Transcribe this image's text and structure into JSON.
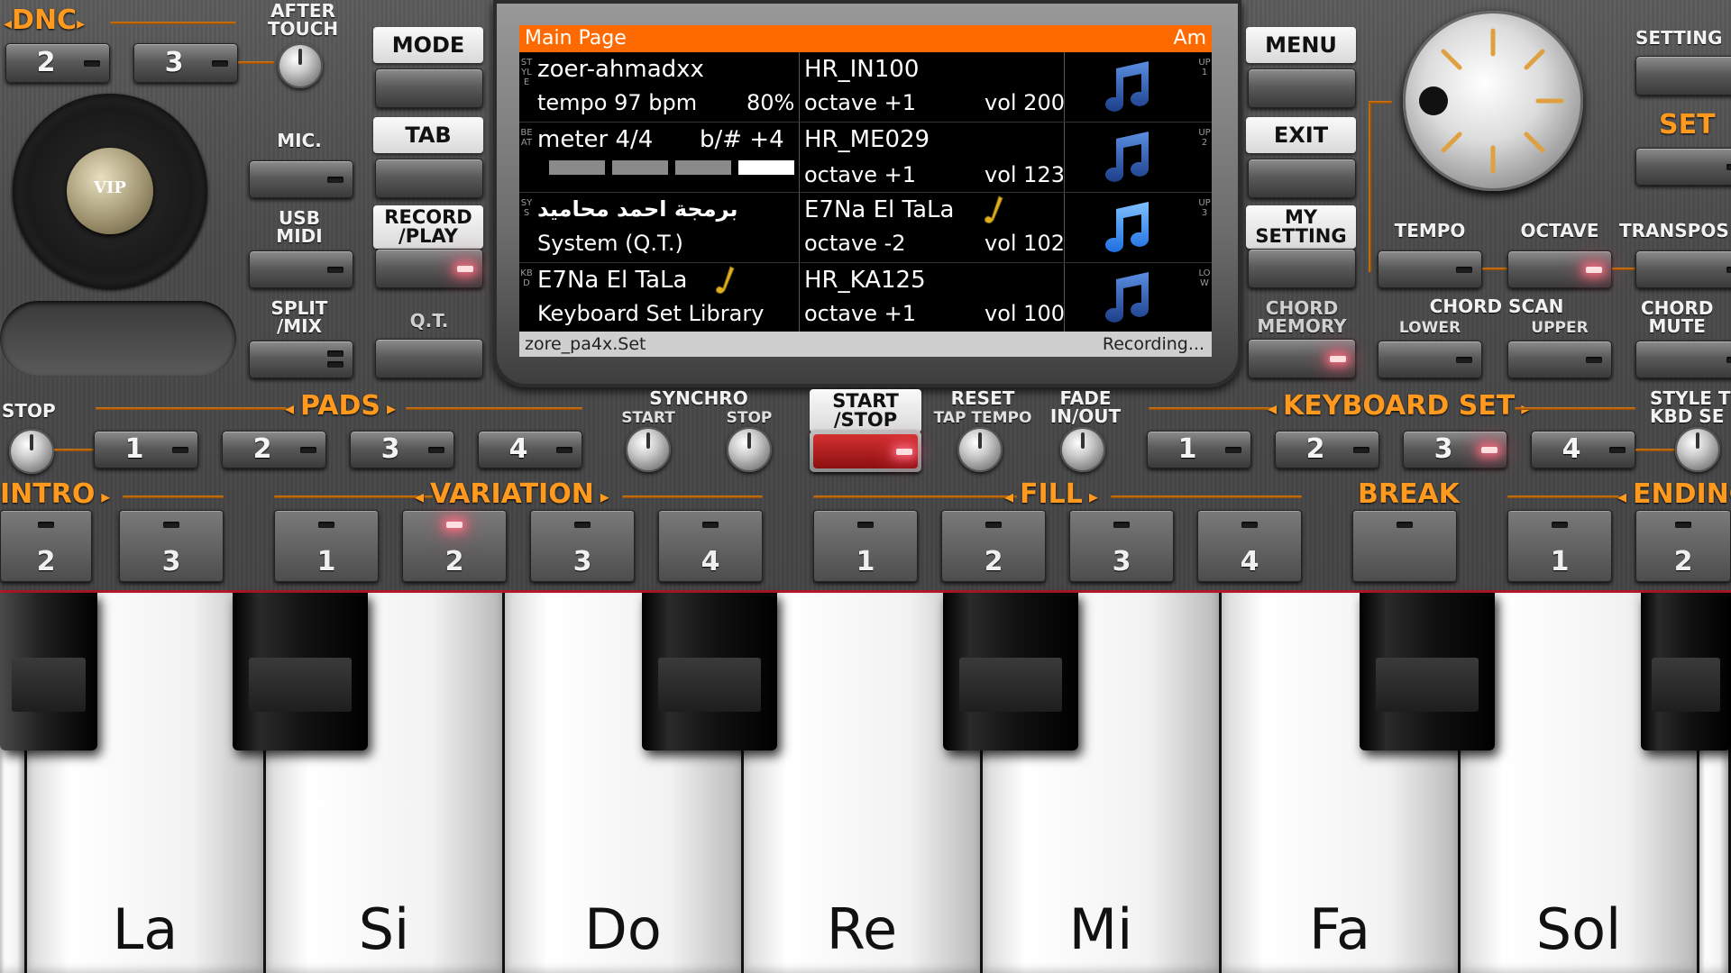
{
  "colors": {
    "accent": "#ff9a1f",
    "screen_header": "#ff6a00",
    "led_on": "#ff6e82",
    "record_button": "#b51d1d"
  },
  "top_left": {
    "dnc": "DNC",
    "dnc_buttons": [
      "2",
      "3"
    ],
    "after_touch": [
      "AFTER",
      "TOUCH"
    ],
    "mic": "MIC.",
    "usb_midi": [
      "USB",
      "MIDI"
    ],
    "split_mix": [
      "SPLIT",
      "/MIX"
    ],
    "logo_text": "VIP"
  },
  "mode_buttons": {
    "mode": "MODE",
    "tab": "TAB",
    "record_play": [
      "RECORD",
      "/PLAY"
    ],
    "qt": "Q.T."
  },
  "screen": {
    "title": "Main Page",
    "key": "Am",
    "rows": [
      {
        "side": "STYLE",
        "left_top": "zoer-ahmadxx",
        "left_bottom": "tempo 97 bpm",
        "left_extra": "80%",
        "right_top": "HR_IN100",
        "right_bottom": "octave +1",
        "volume": "vol 200",
        "tag": "UP1",
        "note_icon": "music-note-dark"
      },
      {
        "side": "BEAT",
        "left_top": "meter 4/4",
        "left_extra": "b/# +4",
        "right_top": "HR_ME029",
        "right_bottom": "octave +1",
        "volume": "vol 123",
        "tag": "UP2",
        "note_icon": "music-note-dark",
        "beat_bars": [
          false,
          false,
          false,
          true
        ]
      },
      {
        "side": "SYS",
        "left_top": "برمجة احمد محاميد",
        "left_bottom": "System (Q.T.)",
        "right_top": "E7Na El TaLa",
        "right_bottom": "octave -2",
        "volume": "vol 102",
        "tag": "UP3",
        "note_icon": "music-note-bright"
      },
      {
        "side": "KBD",
        "left_top": "E7Na El TaLa",
        "left_bottom": "Keyboard Set Library",
        "right_top": "HR_KA125",
        "right_bottom": "octave +1",
        "volume": "vol 100",
        "tag": "LOW",
        "note_icon": "music-note-dark"
      }
    ],
    "footer_left": "zore_pa4x.Set",
    "footer_right": "Recording..."
  },
  "menu_buttons": {
    "menu": "MENU",
    "exit": "EXIT",
    "my_setting": [
      "MY",
      "SETTING"
    ],
    "chord_memory": [
      "CHORD",
      "MEMORY"
    ]
  },
  "right_top": {
    "setting": "SETTING",
    "set": "SET",
    "tempo": "TEMPO",
    "octave": "OCTAVE",
    "transpose": "TRANSPOS",
    "chord_scan": "CHORD SCAN",
    "lower": "LOWER",
    "upper": "UPPER",
    "chord_mute": [
      "CHORD",
      "MUTE"
    ]
  },
  "pads_row": {
    "stop": "STOP",
    "pads": "PADS",
    "pad_buttons": [
      "1",
      "2",
      "3",
      "4"
    ],
    "synchro": "SYNCHRO",
    "synchro_start": "START",
    "synchro_stop": "STOP",
    "start_stop": [
      "START",
      "/STOP"
    ],
    "reset": "RESET",
    "tap_tempo": "TAP TEMPO",
    "fade": [
      "FADE",
      "IN/OUT"
    ],
    "keyboard_set": "KEYBOARD SET",
    "kbd_buttons": [
      "1",
      "2",
      "3",
      "4"
    ],
    "style_to_kbd": [
      "STYLE T",
      "KBD SE"
    ]
  },
  "sections": {
    "intro": "INTRO",
    "intro_buttons": [
      "2",
      "3"
    ],
    "variation": "VARIATION",
    "variation_buttons": [
      "1",
      "2",
      "3",
      "4"
    ],
    "fill": "FILL",
    "fill_buttons": [
      "1",
      "2",
      "3",
      "4"
    ],
    "break": "BREAK",
    "ending": "ENDING",
    "ending_buttons": [
      "1",
      "2"
    ]
  },
  "keyboard": {
    "white_keys": [
      "",
      "La",
      "Si",
      "Do",
      "Re",
      "Mi",
      "Fa",
      "Sol",
      ""
    ]
  }
}
